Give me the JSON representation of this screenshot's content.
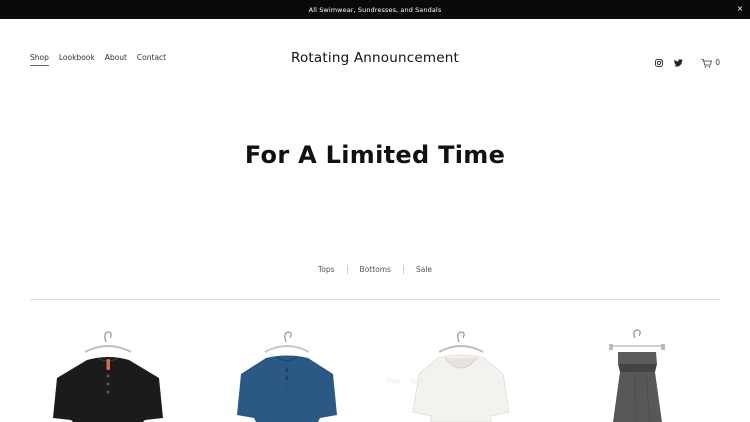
{
  "announcement": {
    "text": "All Swimwear, Sundresses, and Sandals",
    "close_glyph": "×"
  },
  "header": {
    "nav": [
      {
        "label": "Shop",
        "active": true
      },
      {
        "label": "Lookbook",
        "active": false
      },
      {
        "label": "About",
        "active": false
      },
      {
        "label": "Contact",
        "active": false
      }
    ],
    "site_title": "Rotating Announcement",
    "social": [
      "instagram-icon",
      "twitter-icon"
    ],
    "cart": {
      "icon": "cart-icon",
      "count": "0"
    }
  },
  "hero": {
    "title": "For A Limited Time"
  },
  "categories": [
    "Tops",
    "Bottoms",
    "Sale"
  ],
  "products": [
    {
      "name": "black-linen-top",
      "color": "#1b1b1b"
    },
    {
      "name": "blue-linen-top",
      "color": "#2c5886"
    },
    {
      "name": "white-top",
      "color": "#f3f2ee"
    },
    {
      "name": "grey-belted-dress",
      "color": "#585858"
    }
  ],
  "colors": {
    "announcement_bg": "#0a0a0a",
    "text": "#111111",
    "divider": "#e2e2e2"
  }
}
